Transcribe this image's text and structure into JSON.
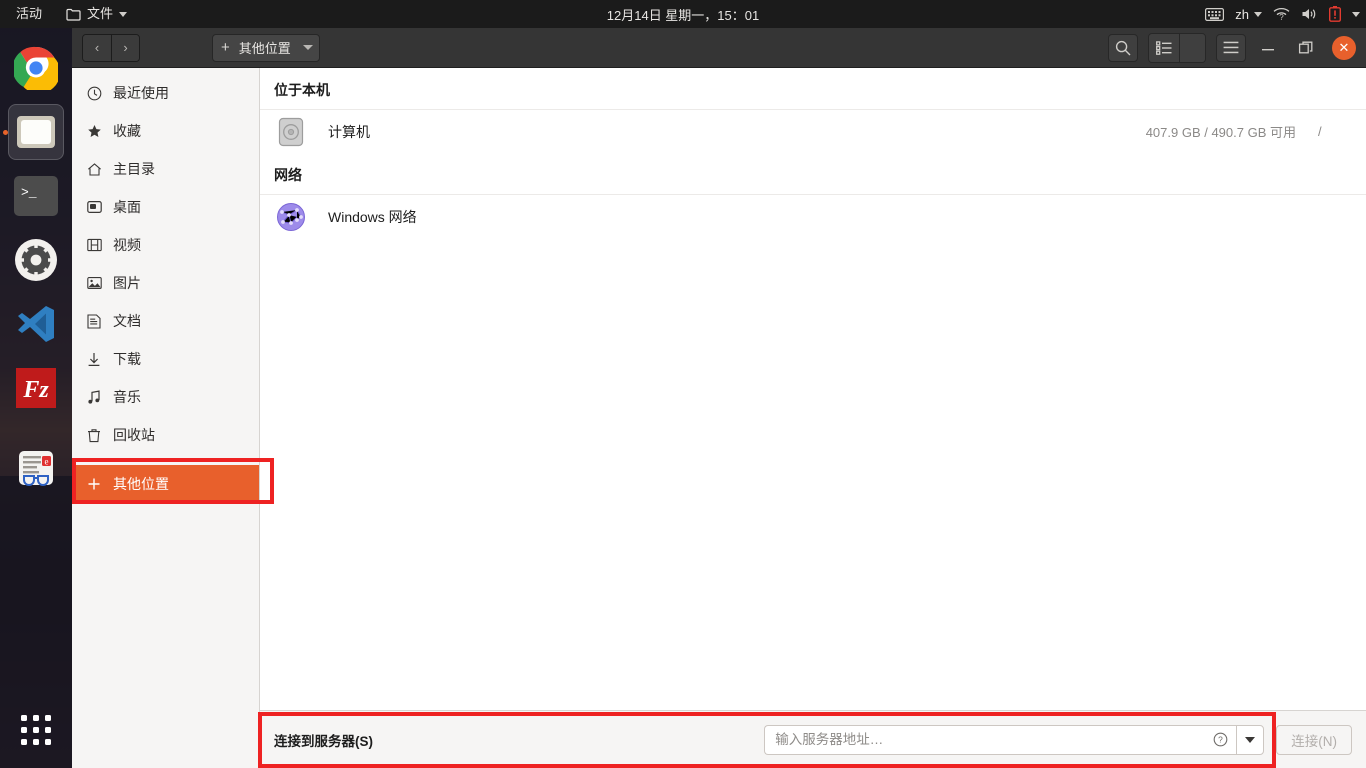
{
  "topbar": {
    "activities": "活动",
    "app_name": "文件",
    "app_icon": "folder-icon",
    "clock": "12月14日 星期一，15：01",
    "indicators": [
      {
        "name": "keyboard-icon",
        "label": ""
      },
      {
        "name": "input-source-indicator",
        "label": "zh"
      },
      {
        "name": "network-icon",
        "label": ""
      },
      {
        "name": "volume-icon",
        "label": ""
      },
      {
        "name": "battery-warning-icon",
        "label": ""
      },
      {
        "name": "system-menu-caret",
        "label": ""
      }
    ]
  },
  "dock": {
    "items": [
      {
        "name": "chrome",
        "active": false
      },
      {
        "name": "files",
        "active": true
      },
      {
        "name": "terminal",
        "active": false
      },
      {
        "name": "settings",
        "active": false
      },
      {
        "name": "vscode",
        "active": false
      },
      {
        "name": "filezilla",
        "active": false
      },
      {
        "name": "reader",
        "active": false
      }
    ],
    "apps_label": "显示应用程序"
  },
  "headerbar": {
    "back_glyph": "‹",
    "forward_glyph": "›",
    "breadcrumb": "其他位置",
    "breadcrumb_plus": "+",
    "search_title": "搜索",
    "view_title": "视图",
    "menu_title": "菜单",
    "minimize_glyph": "—",
    "close_glyph": "✕"
  },
  "sidebar": {
    "items": [
      {
        "label": "最近使用",
        "icon": "clock-icon"
      },
      {
        "label": "收藏",
        "icon": "star-icon"
      },
      {
        "label": "主目录",
        "icon": "home-icon"
      },
      {
        "label": "桌面",
        "icon": "desktop-icon"
      },
      {
        "label": "视频",
        "icon": "video-icon"
      },
      {
        "label": "图片",
        "icon": "picture-icon"
      },
      {
        "label": "文档",
        "icon": "document-icon"
      },
      {
        "label": "下载",
        "icon": "download-icon"
      },
      {
        "label": "音乐",
        "icon": "music-icon"
      },
      {
        "label": "回收站",
        "icon": "trash-icon"
      }
    ],
    "other_locations": {
      "label": "其他位置",
      "plus": "+",
      "selected": true
    }
  },
  "content": {
    "section_local": "位于本机",
    "section_network": "网络",
    "local_rows": [
      {
        "name": "计算机",
        "icon": "disk-icon",
        "meta": "407.9 GB / 490.7 GB 可用",
        "mount": "/"
      }
    ],
    "network_rows": [
      {
        "name": "Windows 网络",
        "icon": "network-globe-icon",
        "meta": "",
        "mount": ""
      }
    ]
  },
  "connect_bar": {
    "label": "连接到服务器(S)",
    "address_value": "",
    "address_placeholder": "输入服务器地址…",
    "help_glyph": "?",
    "connect_label": "连接(N)"
  },
  "colors": {
    "accent_orange": "#e8602c",
    "annotation_red": "#ee2222",
    "headerbar_dark": "#353535",
    "sidebar_bg": "#f6f5f4"
  }
}
